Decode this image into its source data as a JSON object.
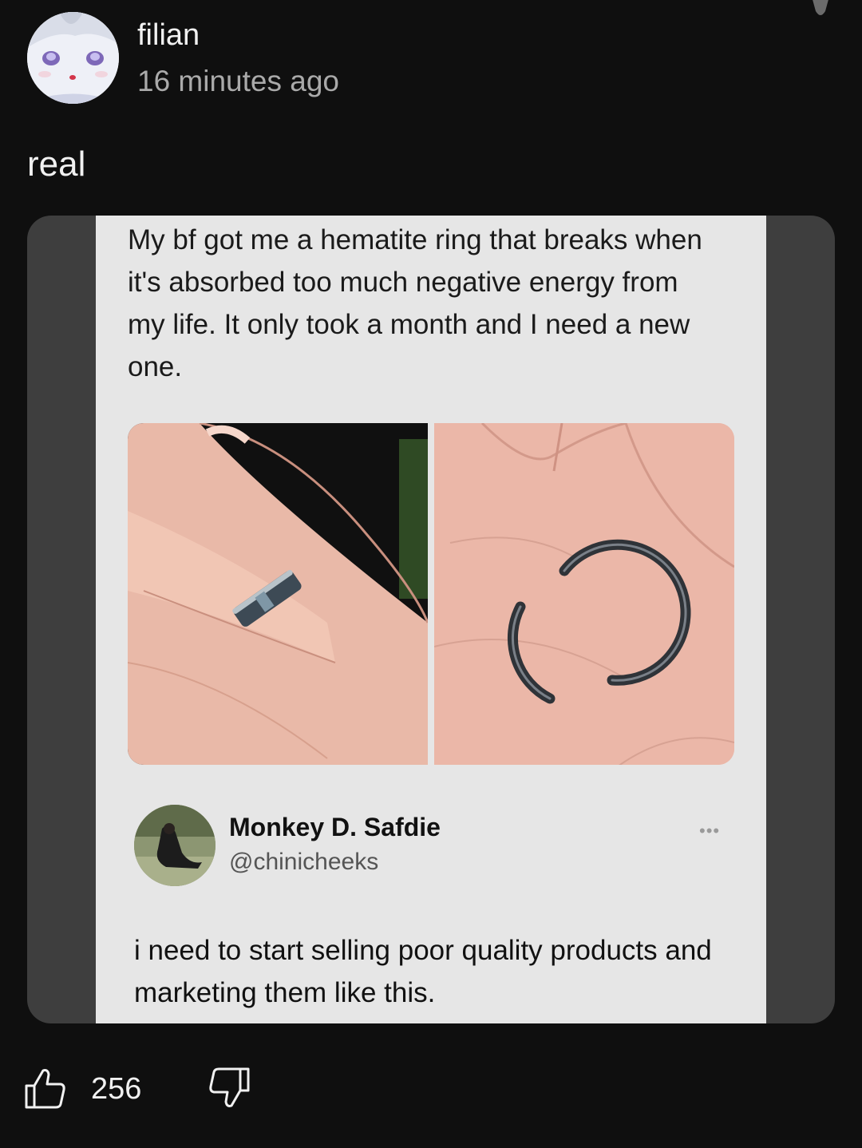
{
  "comment": {
    "author": "filian",
    "timestamp": "16 minutes ago",
    "text": "real",
    "avatar_icon": "avatar-anime-girl"
  },
  "attachment": {
    "meme_caption": "My bf got me a hematite ring that breaks when it's absorbed too much negative energy from my life. It only took a month and I need a new one.",
    "photos": [
      "hand-wearing-ring-photo",
      "broken-ring-in-palm-photo"
    ],
    "tweet": {
      "display_name": "Monkey D. Safdie",
      "handle": "@chinicheeks",
      "more_label": "•••",
      "text": "i need to start selling poor quality products and marketing them like this."
    }
  },
  "actions": {
    "like_count": "256",
    "like_icon": "thumbs-up-icon",
    "dislike_icon": "thumbs-down-icon"
  },
  "colors": {
    "background": "#0f0f0f",
    "attachment_bg": "#3e3e3e",
    "meme_bg": "#e6e6e6",
    "secondary_text": "#aaaaaa"
  }
}
